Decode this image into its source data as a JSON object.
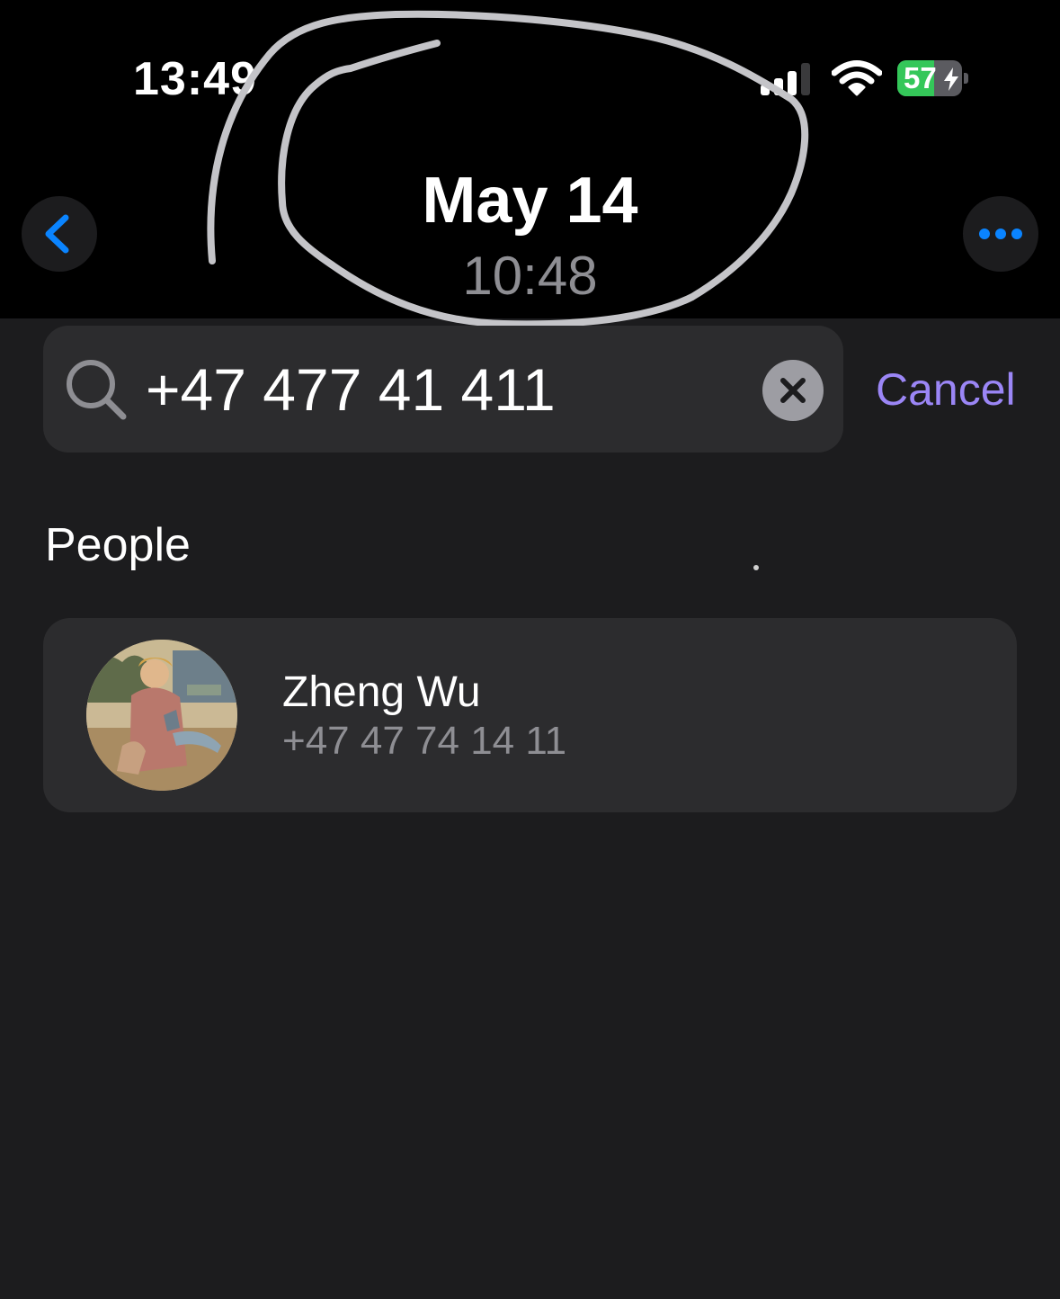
{
  "status_bar": {
    "time": "13:49",
    "battery_percent": "57",
    "battery_level": 0.57,
    "battery_state": "charging",
    "signal_bars_active": 3,
    "icons": [
      "cellular-signal-icon",
      "wifi-icon",
      "battery-icon",
      "charging-bolt-icon"
    ]
  },
  "header": {
    "title": "May 14",
    "subtitle": "10:48",
    "back_icon": "chevron-left-icon",
    "more_icon": "ellipsis-icon"
  },
  "search": {
    "value": "+47 477 41 411",
    "icon": "magnifying-glass-icon",
    "clear_icon": "xmark-circle-icon",
    "cancel_label": "Cancel"
  },
  "results": {
    "section_title": "People",
    "people": [
      {
        "name": "Zheng Wu",
        "phone": "+47 47 74 14 11"
      }
    ]
  },
  "colors": {
    "accent_blue": "#0a84ff",
    "cancel_purple": "#9b86f6",
    "background_top": "#000000",
    "background_main": "#1c1c1e",
    "card": "#2c2c2e",
    "secondary_text": "#8e8e93",
    "battery_green": "#34c759"
  }
}
